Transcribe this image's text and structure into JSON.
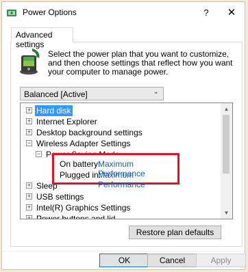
{
  "window": {
    "title": "Power Options",
    "help_glyph": "?",
    "close_glyph": "✕"
  },
  "tabs": [
    {
      "label": "Advanced settings",
      "active": true
    }
  ],
  "intro_text": "Select the power plan that you want to customize, and then choose settings that reflect how you want your computer to manage power.",
  "plan_dropdown": {
    "value": "Balanced [Active]"
  },
  "tree": {
    "items": [
      {
        "label": "Hard disk",
        "expander": "+",
        "selected": true
      },
      {
        "label": "Internet Explorer",
        "expander": "+"
      },
      {
        "label": "Desktop background settings",
        "expander": "+"
      },
      {
        "label": "Wireless Adapter Settings",
        "expander": "−"
      },
      {
        "label": "Power Saving Mode",
        "expander": "−"
      },
      {
        "label": "Sleep",
        "expander": "+"
      },
      {
        "label": "USB settings",
        "expander": "+"
      },
      {
        "label": "Intel(R) Graphics Settings",
        "expander": "+"
      },
      {
        "label": "Power buttons and lid",
        "expander": "+"
      }
    ]
  },
  "power_saving_mode": {
    "on_battery_label": "On battery:",
    "on_battery_value": "Maximum Performance",
    "plugged_in_label": "Plugged in:",
    "plugged_in_value": "Maximum Performance"
  },
  "buttons": {
    "restore": "Restore plan defaults",
    "ok": "OK",
    "cancel": "Cancel",
    "apply": "Apply"
  },
  "colors": {
    "highlight": "#3399ff",
    "callout_border": "#e3101e",
    "link_value": "#1a5fb4"
  },
  "icons": [
    "power-options-icon",
    "power-plan-icon",
    "help-icon",
    "close-icon",
    "chevron-down-icon"
  ]
}
